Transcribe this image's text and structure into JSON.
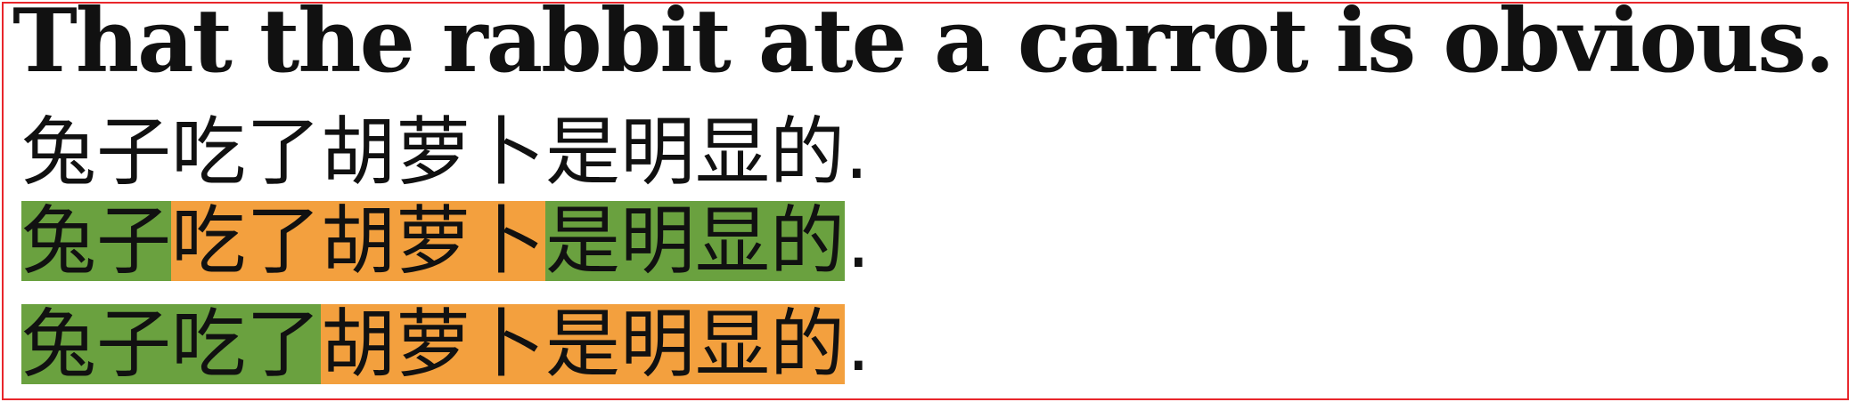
{
  "headline": "That the rabbit ate a carrot is obvious.",
  "plain_sentence": "兔子吃了胡萝卜是明显的.",
  "segmented_1": {
    "segments": [
      {
        "text": "兔子",
        "color": "#6aa13f"
      },
      {
        "text": "吃了胡萝卜",
        "color": "#f3a03e"
      },
      {
        "text": "是明显的",
        "color": "#6aa13f"
      }
    ],
    "trailing": "."
  },
  "segmented_2": {
    "segments": [
      {
        "text": "兔子吃了",
        "color": "#6aa13f"
      },
      {
        "text": "胡萝卜是明显的",
        "color": "#f3a03e"
      }
    ],
    "trailing": "."
  },
  "colors": {
    "frame_border": "#e8262b",
    "green": "#6aa13f",
    "orange": "#f3a03e"
  }
}
